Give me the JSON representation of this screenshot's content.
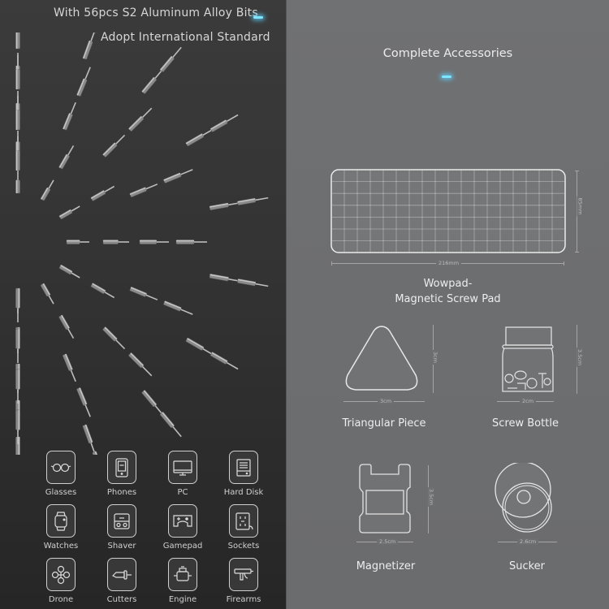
{
  "left_panel": {
    "headline": "With 56pcs S2 Aluminum Alloy Bits",
    "subheadline": "Adopt International Standard",
    "applications": [
      {
        "label": "Glasses",
        "icon": "glasses-icon"
      },
      {
        "label": "Phones",
        "icon": "phone-icon"
      },
      {
        "label": "PC",
        "icon": "monitor-icon"
      },
      {
        "label": "Hard Disk",
        "icon": "hard-disk-icon"
      },
      {
        "label": "Watches",
        "icon": "watch-icon"
      },
      {
        "label": "Shaver",
        "icon": "shaver-icon"
      },
      {
        "label": "Gamepad",
        "icon": "gamepad-icon"
      },
      {
        "label": "Sockets",
        "icon": "socket-icon"
      },
      {
        "label": "Drone",
        "icon": "drone-icon"
      },
      {
        "label": "Cutters",
        "icon": "cutter-icon"
      },
      {
        "label": "Engine",
        "icon": "engine-icon"
      },
      {
        "label": "Firearms",
        "icon": "firearm-icon"
      }
    ]
  },
  "right_panel": {
    "title": "Complete Accessories",
    "accessories": {
      "pad": {
        "name_line1": "Wowpad-",
        "name_line2": "Magnetic Screw Pad",
        "width": "216mm",
        "height": "85mm"
      },
      "triangle": {
        "name": "Triangular Piece",
        "width": "3cm",
        "height": "3cm"
      },
      "bottle": {
        "name": "Screw Bottle",
        "width": "2cm",
        "height": "3.5cm"
      },
      "magnetizer": {
        "name": "Magnetizer",
        "width": "2.5cm",
        "height": "3.5cm"
      },
      "sucker": {
        "name": "Sucker",
        "width": "2.6cm"
      }
    }
  },
  "colors": {
    "accent_glow": "#7fe6ff",
    "left_bg": "#333333",
    "right_bg": "#6e6f71",
    "text": "#d6d6d6"
  }
}
